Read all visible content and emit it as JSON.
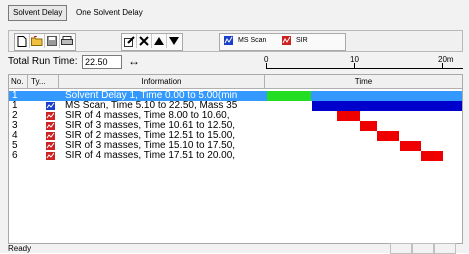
{
  "tabs": {
    "active_tab": "Solvent Delay",
    "second_tab": "One Solvent Delay"
  },
  "toolbar": {
    "new_icon": "new-document-icon",
    "open_icon": "open-folder-icon",
    "save_icon": "save-icon",
    "print_icon": "print-icon",
    "edit_icon": "edit-icon",
    "delete_icon": "delete-x-icon",
    "up_icon": "move-up-icon",
    "down_icon": "move-down-icon",
    "ms_scan_label": "MS Scan",
    "sir_label": "SIR"
  },
  "run_time": {
    "label": "Total Run Time:",
    "value": "22.50",
    "unit_icon": "stretch-arrows-icon"
  },
  "ruler": {
    "labels": [
      "0",
      "10",
      "20m"
    ],
    "min": 0,
    "max": 22.5
  },
  "table": {
    "columns": [
      "No.",
      "Ty...",
      "Information",
      "Time"
    ],
    "rows": [
      {
        "no": "1",
        "type": "solvent-delay",
        "info": "Solvent Delay 1, Time 0.00 to 5.00(min",
        "start": 0.0,
        "end": 5.0,
        "color": "#22dd22",
        "selected": true
      },
      {
        "no": "1",
        "type": "ms-scan",
        "info": "MS Scan, Time 5.10 to 22.50, Mass 35",
        "start": 5.1,
        "end": 22.5,
        "color": "#0000cc",
        "selected": false
      },
      {
        "no": "2",
        "type": "sir",
        "info": "SIR of 4 masses, Time 8.00 to 10.60,",
        "start": 8.0,
        "end": 10.6,
        "color": "#ee0000",
        "selected": false
      },
      {
        "no": "3",
        "type": "sir",
        "info": "SIR of 3 masses, Time 10.61 to 12.50,",
        "start": 10.61,
        "end": 12.5,
        "color": "#ee0000",
        "selected": false
      },
      {
        "no": "4",
        "type": "sir",
        "info": "SIR of 2 masses, Time 12.51 to 15.00,",
        "start": 12.51,
        "end": 15.0,
        "color": "#ee0000",
        "selected": false
      },
      {
        "no": "5",
        "type": "sir",
        "info": "SIR of 3 masses, Time 15.10 to 17.50,",
        "start": 15.1,
        "end": 17.5,
        "color": "#ee0000",
        "selected": false
      },
      {
        "no": "6",
        "type": "sir",
        "info": "SIR of 4 masses, Time 17.51 to 20.00,",
        "start": 17.51,
        "end": 20.0,
        "color": "#ee0000",
        "selected": false
      }
    ]
  },
  "status": {
    "text": "Ready"
  },
  "colors": {
    "ms_scan_icon": "#1a3fcc",
    "sir_icon": "#cc2222",
    "selection": "#3399ff"
  }
}
